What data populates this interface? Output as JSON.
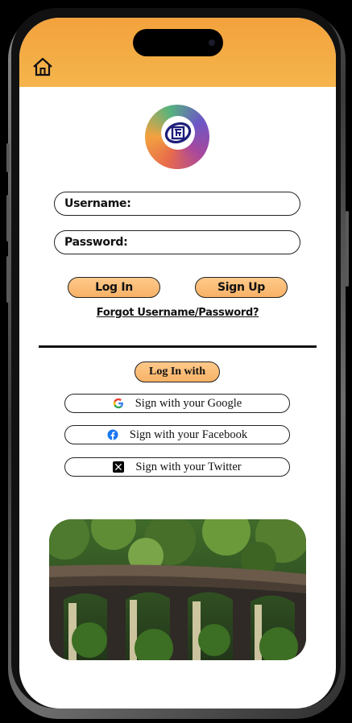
{
  "header": {
    "home_icon": "home-icon",
    "color": "#f5ac44"
  },
  "logo": {
    "icon": "irctc-logo"
  },
  "form": {
    "username_label": "Username:",
    "username_value": "",
    "password_label": "Password:",
    "password_value": ""
  },
  "actions": {
    "login_label": "Log In",
    "signup_label": "Sign Up",
    "forgot_label": "Forgot Username/Password?"
  },
  "social": {
    "heading": "Log In with",
    "items": [
      {
        "label": "Sign with your Google",
        "icon": "google-icon"
      },
      {
        "label": "Sign with your Facebook",
        "icon": "facebook-icon"
      },
      {
        "label": "Sign with your Twitter",
        "icon": "x-twitter-icon"
      }
    ]
  },
  "image": {
    "subject": "railway-viaduct-photo"
  },
  "colors": {
    "accent": "#f7b267",
    "header": "#f5ac44",
    "text": "#111111"
  }
}
